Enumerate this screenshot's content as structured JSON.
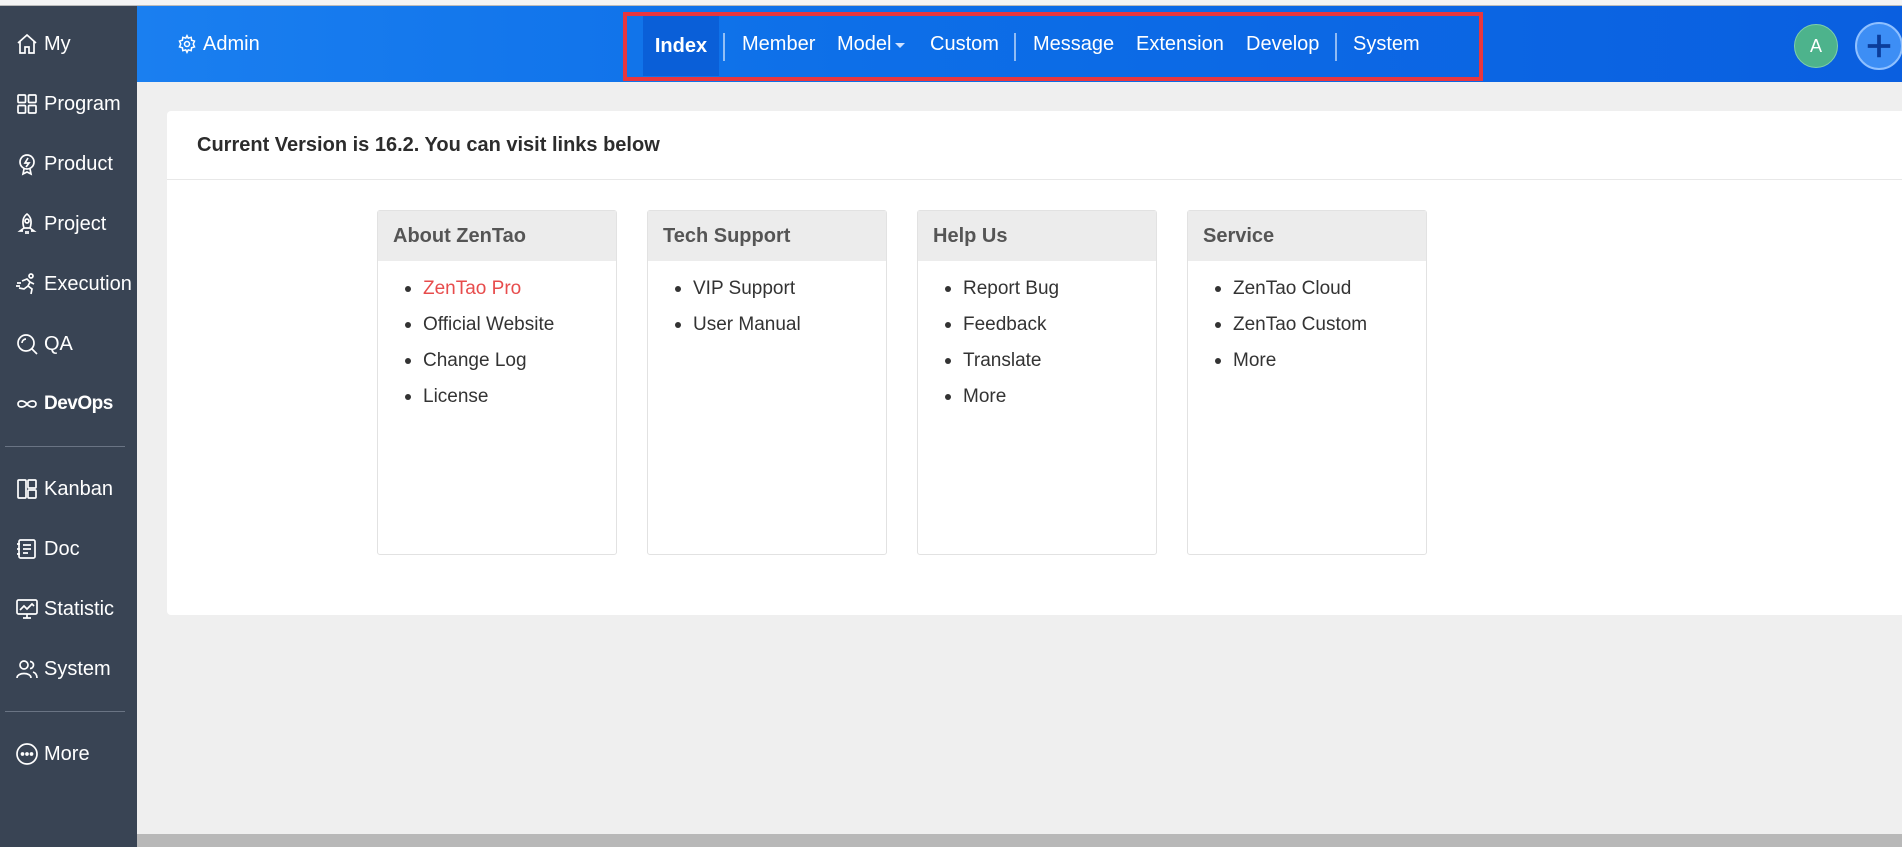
{
  "sidebar": {
    "items": [
      {
        "label": "My",
        "icon": "home-icon"
      },
      {
        "label": "Program",
        "icon": "grid-icon"
      },
      {
        "label": "Product",
        "icon": "bulb-icon"
      },
      {
        "label": "Project",
        "icon": "rocket-icon"
      },
      {
        "label": "Execution",
        "icon": "runner-icon"
      },
      {
        "label": "QA",
        "icon": "qa-magnifier-icon"
      },
      {
        "label": "DevOps",
        "icon": "infinity-icon"
      },
      {
        "label": "Kanban",
        "icon": "kanban-icon"
      },
      {
        "label": "Doc",
        "icon": "doc-icon"
      },
      {
        "label": "Statistic",
        "icon": "monitor-chart-icon"
      },
      {
        "label": "System",
        "icon": "users-icon"
      },
      {
        "label": "More",
        "icon": "more-dots-icon"
      }
    ]
  },
  "header": {
    "admin_label": "Admin",
    "menu": [
      {
        "label": "Index",
        "active": true
      },
      {
        "label": "Member"
      },
      {
        "label": "Model",
        "dropdown": true
      },
      {
        "label": "Custom"
      },
      {
        "label": "Message"
      },
      {
        "label": "Extension"
      },
      {
        "label": "Develop"
      },
      {
        "label": "System"
      }
    ],
    "avatar_letter": "A",
    "highlight_color": "#e8363e"
  },
  "main": {
    "title": "Current Version is 16.2. You can visit links below",
    "cards": [
      {
        "title": "About ZenTao",
        "links": [
          "ZenTao Pro",
          "Official Website",
          "Change Log",
          "License"
        ],
        "highlight_index": 0
      },
      {
        "title": "Tech Support",
        "links": [
          "VIP Support",
          "User Manual"
        ]
      },
      {
        "title": "Help Us",
        "links": [
          "Report Bug",
          "Feedback",
          "Translate",
          "More"
        ]
      },
      {
        "title": "Service",
        "links": [
          "ZenTao Cloud",
          "ZenTao Custom",
          "More"
        ]
      }
    ]
  }
}
